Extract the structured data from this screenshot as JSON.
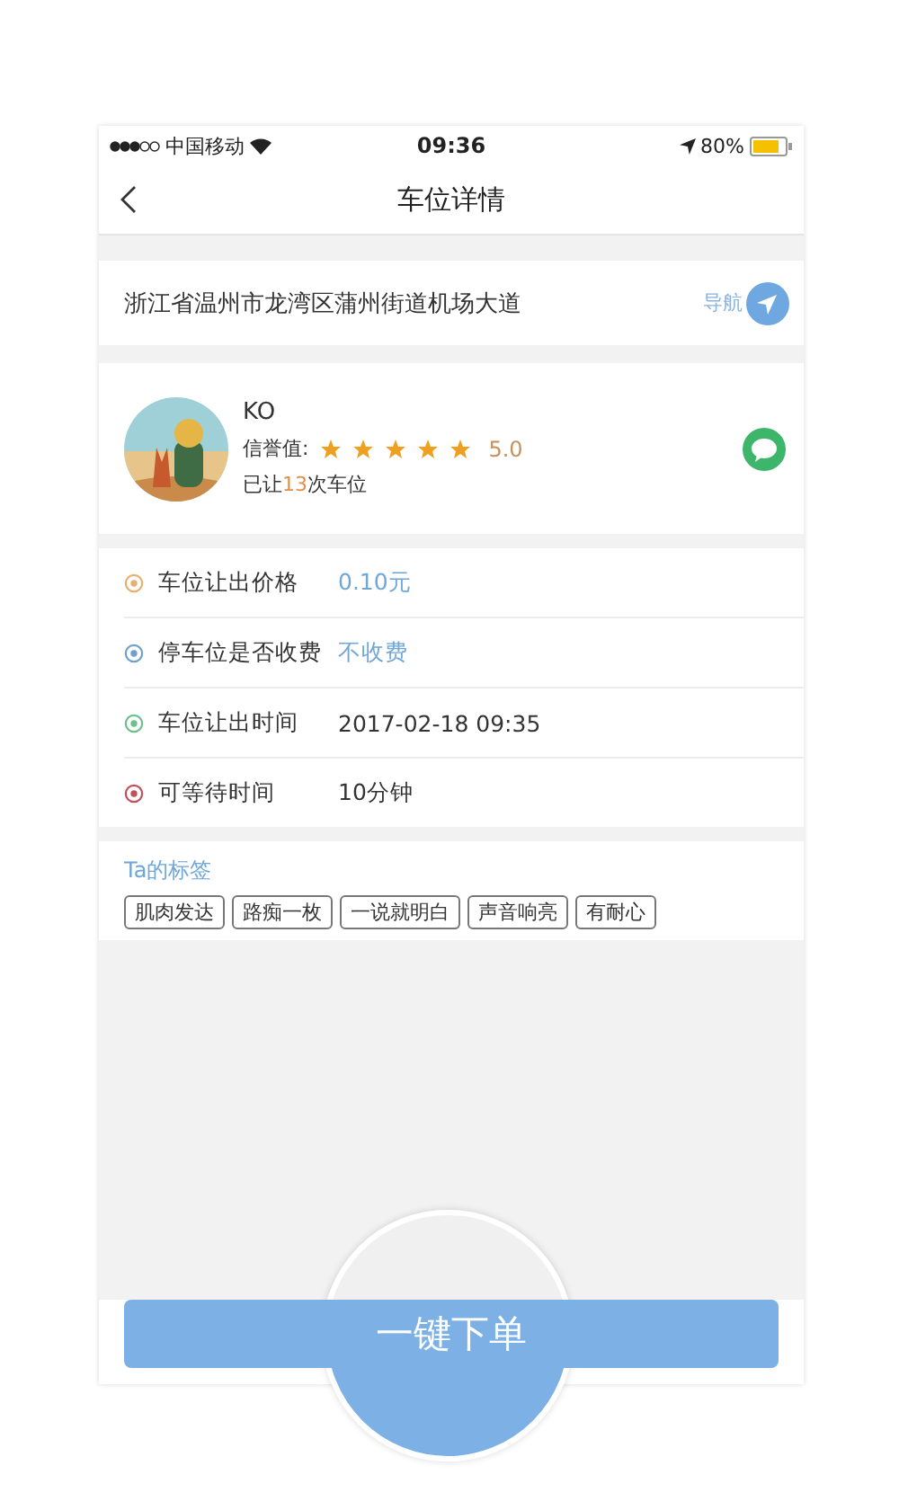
{
  "status_bar": {
    "carrier": "中国移动",
    "time": "09:36",
    "battery": "80%"
  },
  "nav": {
    "title": "车位详情"
  },
  "address": {
    "text": "浙江省温州市龙湾区蒲州街道机场大道",
    "nav_label": "导航"
  },
  "profile": {
    "name": "KO",
    "rating_label": "信誉值:",
    "stars": 5,
    "score": "5.0",
    "count_text": [
      "已让",
      "13",
      "次车位"
    ]
  },
  "details": [
    {
      "label": "车位让出价格",
      "value": "0.10元",
      "highlight": true,
      "color": "#e8b070"
    },
    {
      "label": "停车位是否收费",
      "value": "不收费",
      "highlight": true,
      "color": "#6fa0d0"
    },
    {
      "label": "车位让出时间",
      "value": "2017-02-18 09:35",
      "highlight": false,
      "color": "#6cc08a"
    },
    {
      "label": "可等待时间",
      "value": "10分钟",
      "highlight": false,
      "color": "#c0505a"
    }
  ],
  "tags": {
    "title": "Ta的标签",
    "items": [
      "肌肉发达",
      "路痴一枚",
      "一说就明白",
      "声音响亮",
      "有耐心"
    ]
  },
  "order_button": {
    "label": "一键下单"
  }
}
